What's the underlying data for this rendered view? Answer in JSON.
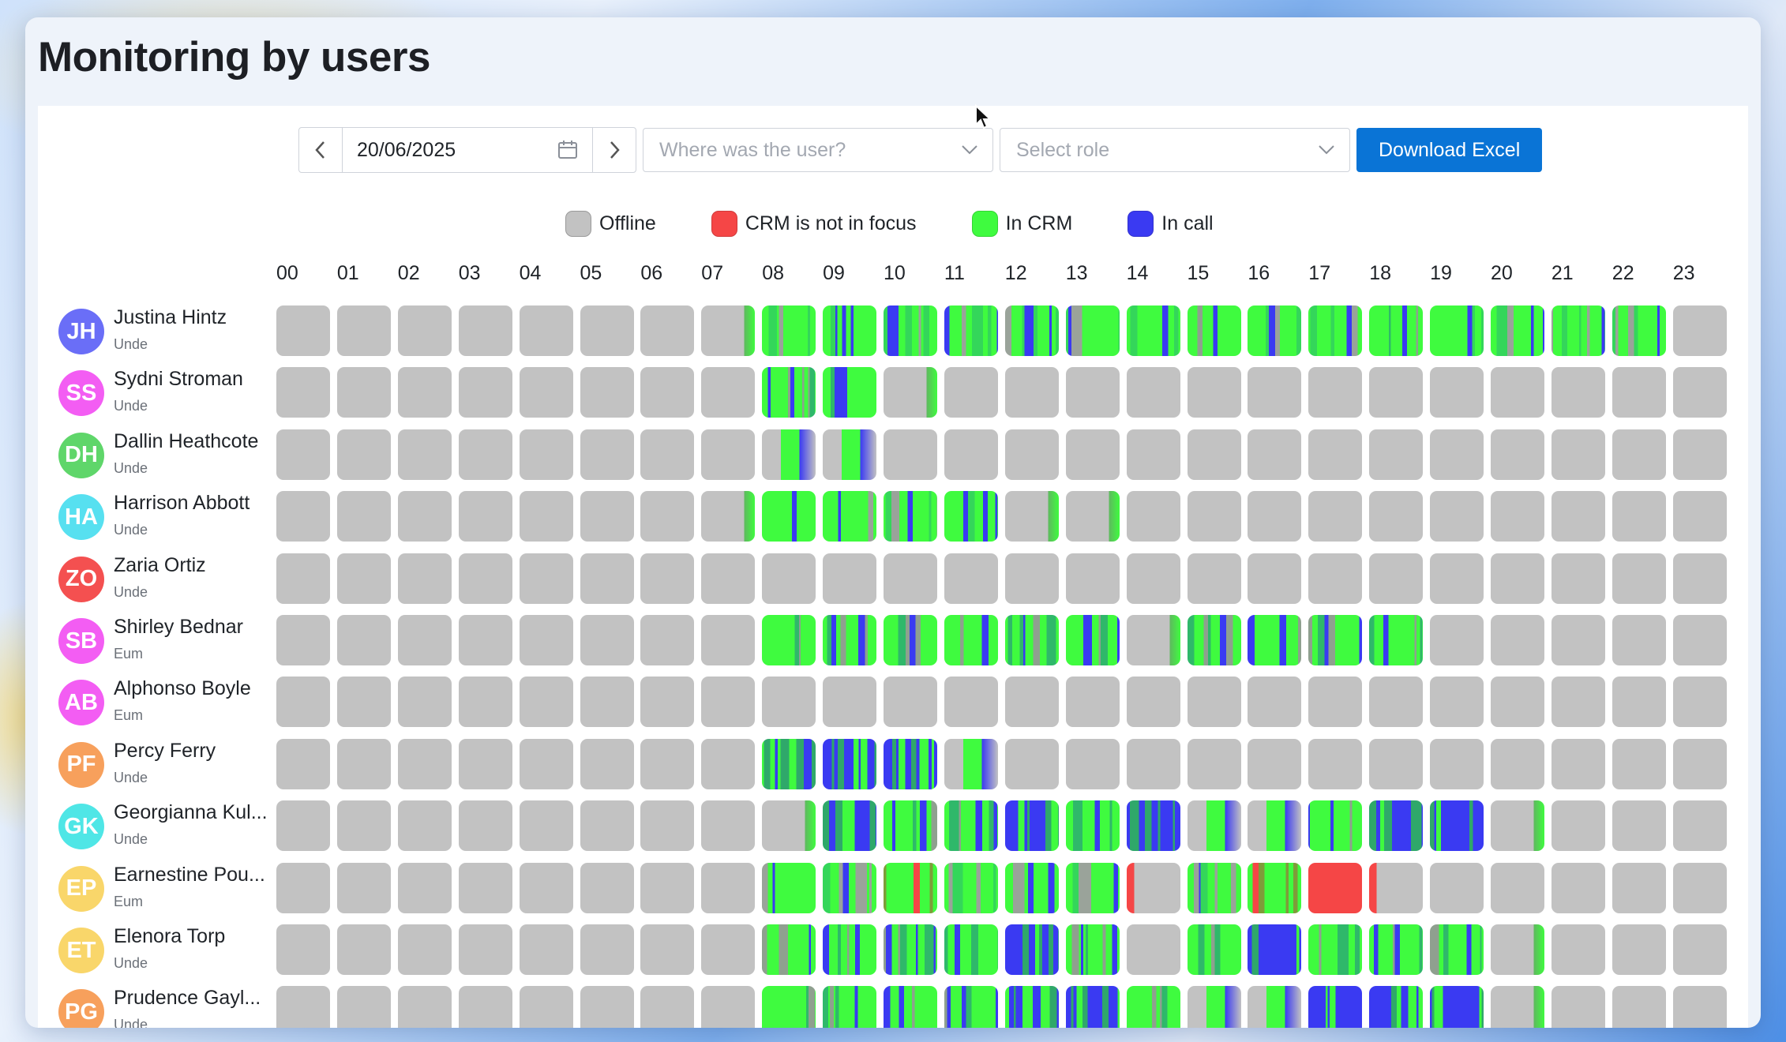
{
  "page": {
    "title": "Monitoring by users"
  },
  "toolbar": {
    "date_value": "20/06/2025",
    "where_placeholder": "Where was the user?",
    "role_placeholder": "Select role",
    "download_label": "Download Excel"
  },
  "legend": [
    {
      "label": "Offline",
      "color": "#c2c2c2"
    },
    {
      "label": "CRM is not in focus",
      "color": "#f54646"
    },
    {
      "label": "In CRM",
      "color": "#3ffb3f"
    },
    {
      "label": "In call",
      "color": "#3a3af2"
    }
  ],
  "colors": {
    "offline": "#c2c2c2",
    "not_focus": "#f54646",
    "in_crm": "#3ffb3f",
    "in_call": "#3a3af2",
    "accent": "#0a74d6"
  },
  "hours": [
    "00",
    "01",
    "02",
    "03",
    "04",
    "05",
    "06",
    "07",
    "08",
    "09",
    "10",
    "11",
    "12",
    "13",
    "14",
    "15",
    "16",
    "17",
    "18",
    "19",
    "20",
    "21",
    "22",
    "23"
  ],
  "users": [
    {
      "initials": "JH",
      "name": "Justina Hintz",
      "role": "Unde",
      "avatar_color": "#6a6ef7",
      "activity": "GGGGGGGgCCCCCCCMCCMCCCCGG"
    },
    {
      "initials": "SS",
      "name": "Sydni Stroman",
      "role": "Unde",
      "avatar_color": "#f35df3",
      "activity": "GGGGGGGGMMgGGGGGGGGGGGGG"
    },
    {
      "initials": "DH",
      "name": "Dallin Heathcote",
      "role": "Unde",
      "avatar_color": "#5fd66a",
      "activity": "GGGGGGGGhhGGGGGGGGGGGGGG"
    },
    {
      "initials": "HA",
      "name": "Harrison Abbott",
      "role": "Unde",
      "avatar_color": "#57e0f0",
      "activity": "GGGGGGGgCCCCggGGGGGGGGGG"
    },
    {
      "initials": "ZO",
      "name": "Zaria Ortiz",
      "role": "Unde",
      "avatar_color": "#f45050",
      "activity": "GGGGGGGGGGGGGGGGGGGGGGGG"
    },
    {
      "initials": "SB",
      "name": "Shirley Bednar",
      "role": "Eum",
      "avatar_color": "#f35df3",
      "activity": "GGGGGGGGMMMMMMgMMMMGGGGG"
    },
    {
      "initials": "AB",
      "name": "Alphonso Boyle",
      "role": "Eum",
      "avatar_color": "#f35df3",
      "activity": "GGGGGGGGGGGGGGGGGGGGGGGG"
    },
    {
      "initials": "PF",
      "name": "Percy Ferry",
      "role": "Unde",
      "avatar_color": "#f7a05c",
      "activity": "GGGGGGGGBBBhGGGGGGGGGGGG"
    },
    {
      "initials": "GK",
      "name": "Georgianna Kul...",
      "role": "Unde",
      "avatar_color": "#4fe6e6",
      "activity": "GGGGGGGGgBMMBMBhhMBBgGGG"
    },
    {
      "initials": "EP",
      "name": "Earnestine Pou...",
      "role": "Eum",
      "avatar_color": "#f9d66a",
      "activity": "GGGGGGGGCCRCCCrCRXrGGGGG"
    },
    {
      "initials": "ET",
      "name": "Elenora Torp",
      "role": "Unde",
      "avatar_color": "#f9d66a",
      "activity": "GGGGGGGGMMMMBMGMBMMMgGGG"
    },
    {
      "initials": "PG",
      "name": "Prudence Gayl...",
      "role": "Unde",
      "avatar_color": "#f7a05c",
      "activity": "GGGGGGGGMMMMBBMhhBBBgGGG"
    }
  ]
}
